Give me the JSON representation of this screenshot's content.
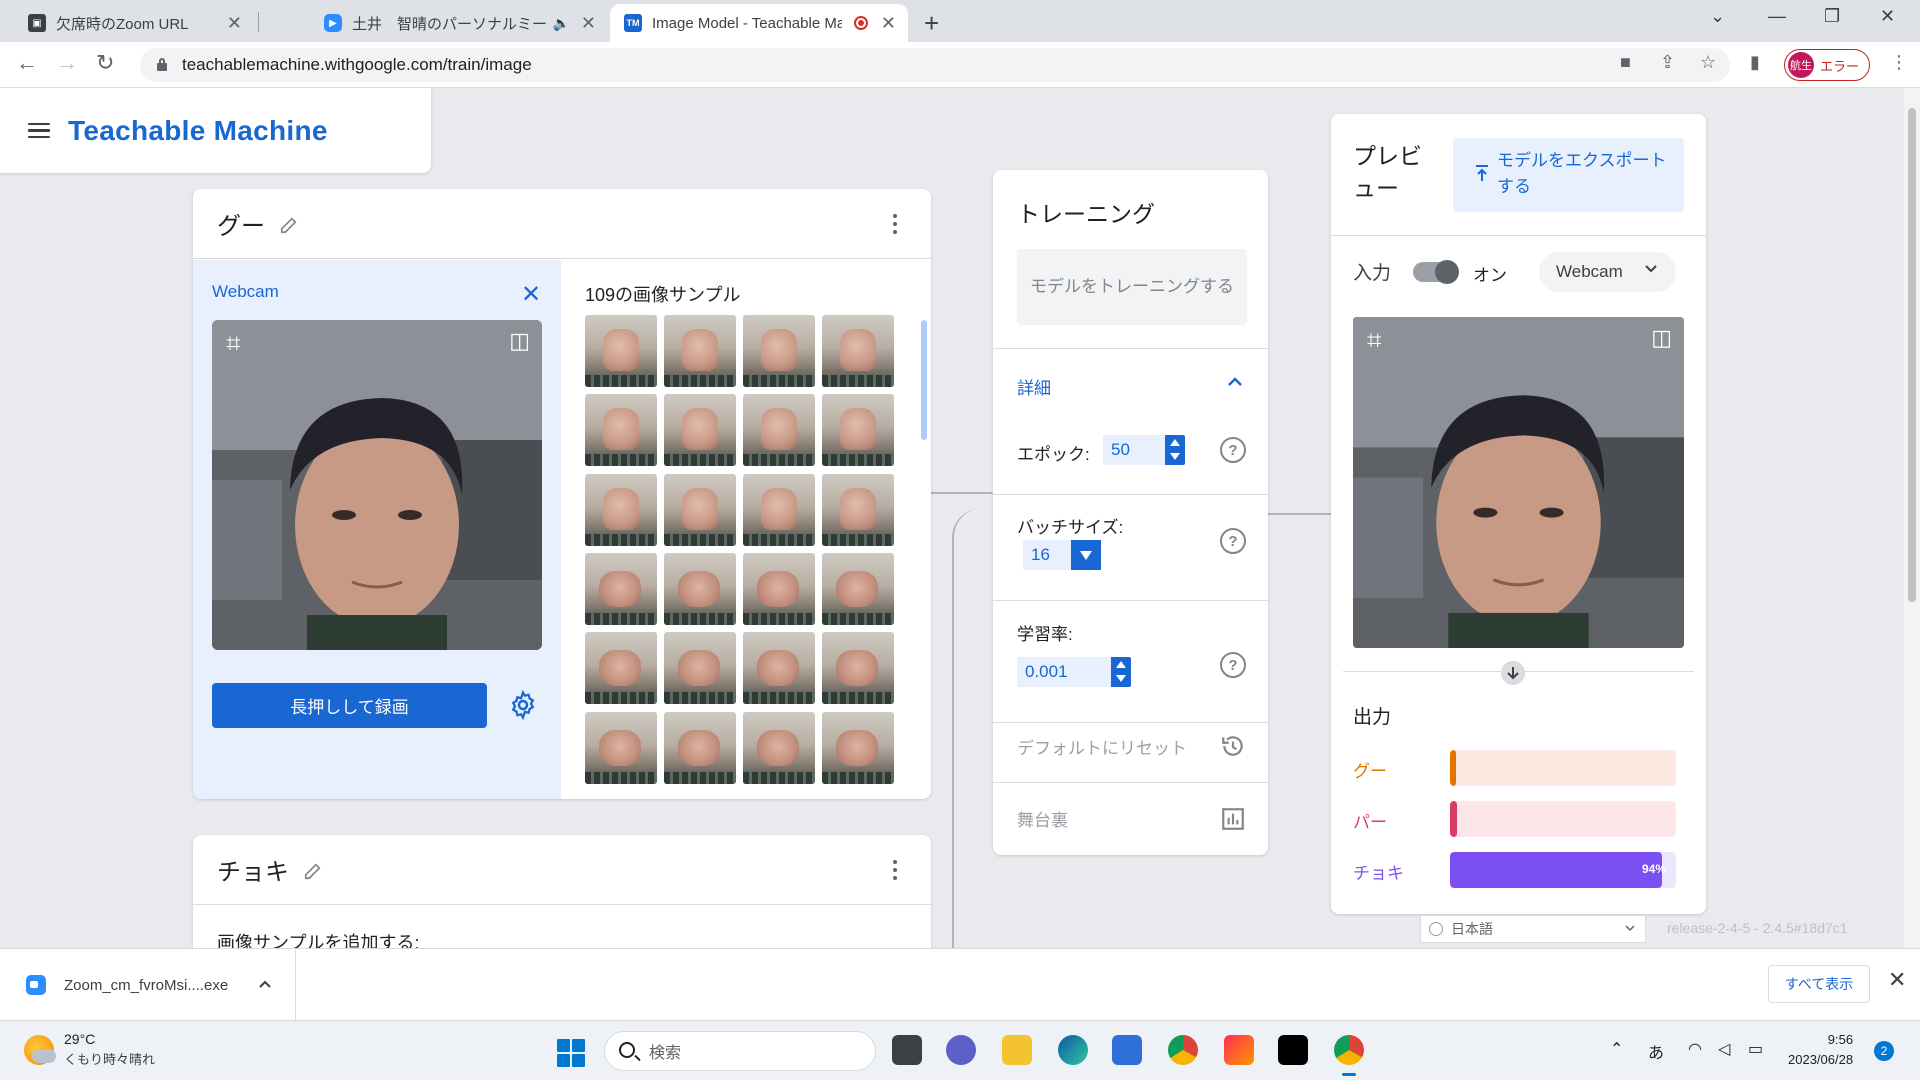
{
  "browser": {
    "tabs": [
      {
        "title": "欠席時のZoom URL",
        "favicon": "classroom-icon",
        "color": "#3c4043"
      },
      {
        "title": "土井　智晴のパーソナルミーティン",
        "favicon": "zoom-icon",
        "color": "#2d8cff"
      },
      {
        "title": "Image Model - Teachable Ma",
        "favicon": "tm-icon",
        "color": "#1967d2"
      }
    ],
    "close_glyph": "✕",
    "new_tab_glyph": "+",
    "url": "teachablemachine.withgoogle.com/train/image",
    "profile_badge": "航生",
    "profile_status": "エラー"
  },
  "app": {
    "brand": "Teachable Machine"
  },
  "class1": {
    "name": "グー",
    "webcam_label": "Webcam",
    "close_glyph": "✕",
    "record_button": "長押しして録画",
    "samples_title": "109の画像サンプル"
  },
  "class2": {
    "name": "チョキ",
    "add_samples": "画像サンプルを追加する:"
  },
  "training": {
    "title": "トレーニング",
    "train_button": "モデルをトレーニングする",
    "details": "詳細",
    "epoch_label": "エポック:",
    "epoch_value": "50",
    "batch_label": "バッチサイズ:",
    "batch_value": "16",
    "lr_label": "学習率:",
    "lr_value": "0.001",
    "help_glyph": "?",
    "reset": "デフォルトにリセット",
    "backstage": "舞台裏"
  },
  "preview": {
    "title": "プレビュー",
    "export_button": "モデルをエクスポートする",
    "input_label": "入力",
    "toggle_label": "オン",
    "source": "Webcam",
    "output_label": "出力",
    "outputs": [
      {
        "label": "グー",
        "value": 0.02,
        "color": "#e37400",
        "track": "#fce8e0",
        "pct": ""
      },
      {
        "label": "パー",
        "value": 0.03,
        "color": "#d93d67",
        "track": "#fde6ea",
        "pct": ""
      },
      {
        "label": "チョキ",
        "value": 0.94,
        "color": "#7b4ff2",
        "track": "#ece7fd",
        "pct": "94%"
      }
    ]
  },
  "footer": {
    "language": "日本語",
    "release": "release-2-4-5 - 2.4.5#18d7c1"
  },
  "downloads": {
    "file": "Zoom_cm_fvroMsi....exe",
    "show_all": "すべて表示",
    "close_glyph": "✕"
  },
  "taskbar": {
    "temperature": "29°C",
    "weather": "くもり時々晴れ",
    "search_placeholder": "検索",
    "ime": "あ",
    "time": "9:56",
    "date": "2023/06/28",
    "notifications": "2"
  }
}
